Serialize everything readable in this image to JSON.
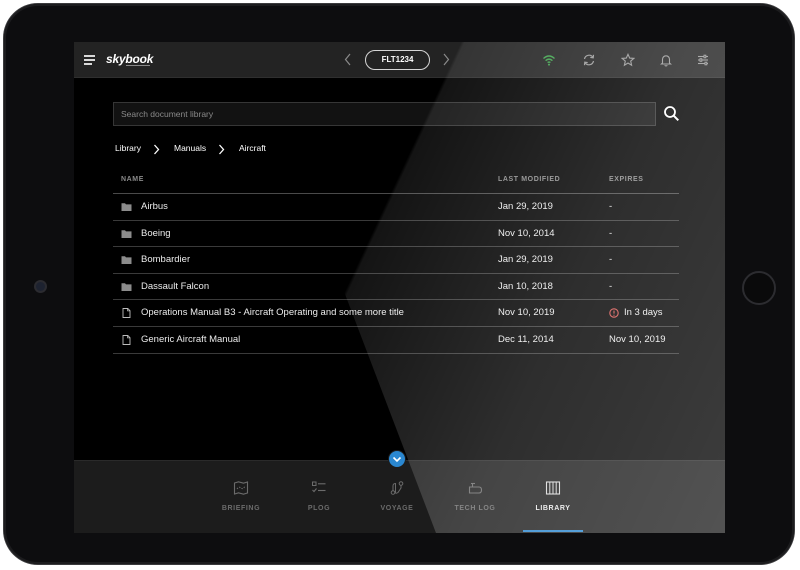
{
  "app": {
    "logo": "skybook",
    "flight": "FLT1234"
  },
  "colors": {
    "accent": "#2a87d0",
    "wifi": "#3fa34d",
    "warning": "#d9534f",
    "background": "#000000",
    "topbar": "#232323"
  },
  "topbar_icons": [
    "menu-icon",
    "chevron-left-icon",
    "chevron-right-icon",
    "wifi-icon",
    "sync-icon",
    "star-icon",
    "bell-icon",
    "settings-sliders-icon"
  ],
  "search": {
    "placeholder": "Search document library"
  },
  "breadcrumb": [
    "Library",
    "Manuals",
    "Aircraft"
  ],
  "table": {
    "headers": {
      "name": "NAME",
      "last_modified": "LAST MODIFIED",
      "expires": "EXPIRES"
    },
    "rows": [
      {
        "type": "folder",
        "name": "Airbus",
        "last_modified": "Jan 29, 2019",
        "expires": "-"
      },
      {
        "type": "folder",
        "name": "Boeing",
        "last_modified": "Nov 10, 2014",
        "expires": "-"
      },
      {
        "type": "folder",
        "name": "Bombardier",
        "last_modified": "Jan 29, 2019",
        "expires": "-"
      },
      {
        "type": "folder",
        "name": "Dassault Falcon",
        "last_modified": "Jan 10, 2018",
        "expires": "-"
      },
      {
        "type": "document",
        "name": "Operations Manual B3 - Aircraft Operating and some more title",
        "last_modified": "Nov 10, 2019",
        "expires": "In 3 days",
        "warning": true
      },
      {
        "type": "document",
        "name": "Generic Aircraft Manual",
        "last_modified": "Dec 11, 2014",
        "expires": "Nov 10, 2019"
      }
    ]
  },
  "bottom_nav": {
    "items": [
      {
        "label": "BRIEFING",
        "icon": "map-icon"
      },
      {
        "label": "PLOG",
        "icon": "checklist-icon"
      },
      {
        "label": "VOYAGE",
        "icon": "route-icon"
      },
      {
        "label": "TECH LOG",
        "icon": "engine-icon"
      },
      {
        "label": "LIBRARY",
        "icon": "books-icon",
        "active": true
      }
    ]
  }
}
